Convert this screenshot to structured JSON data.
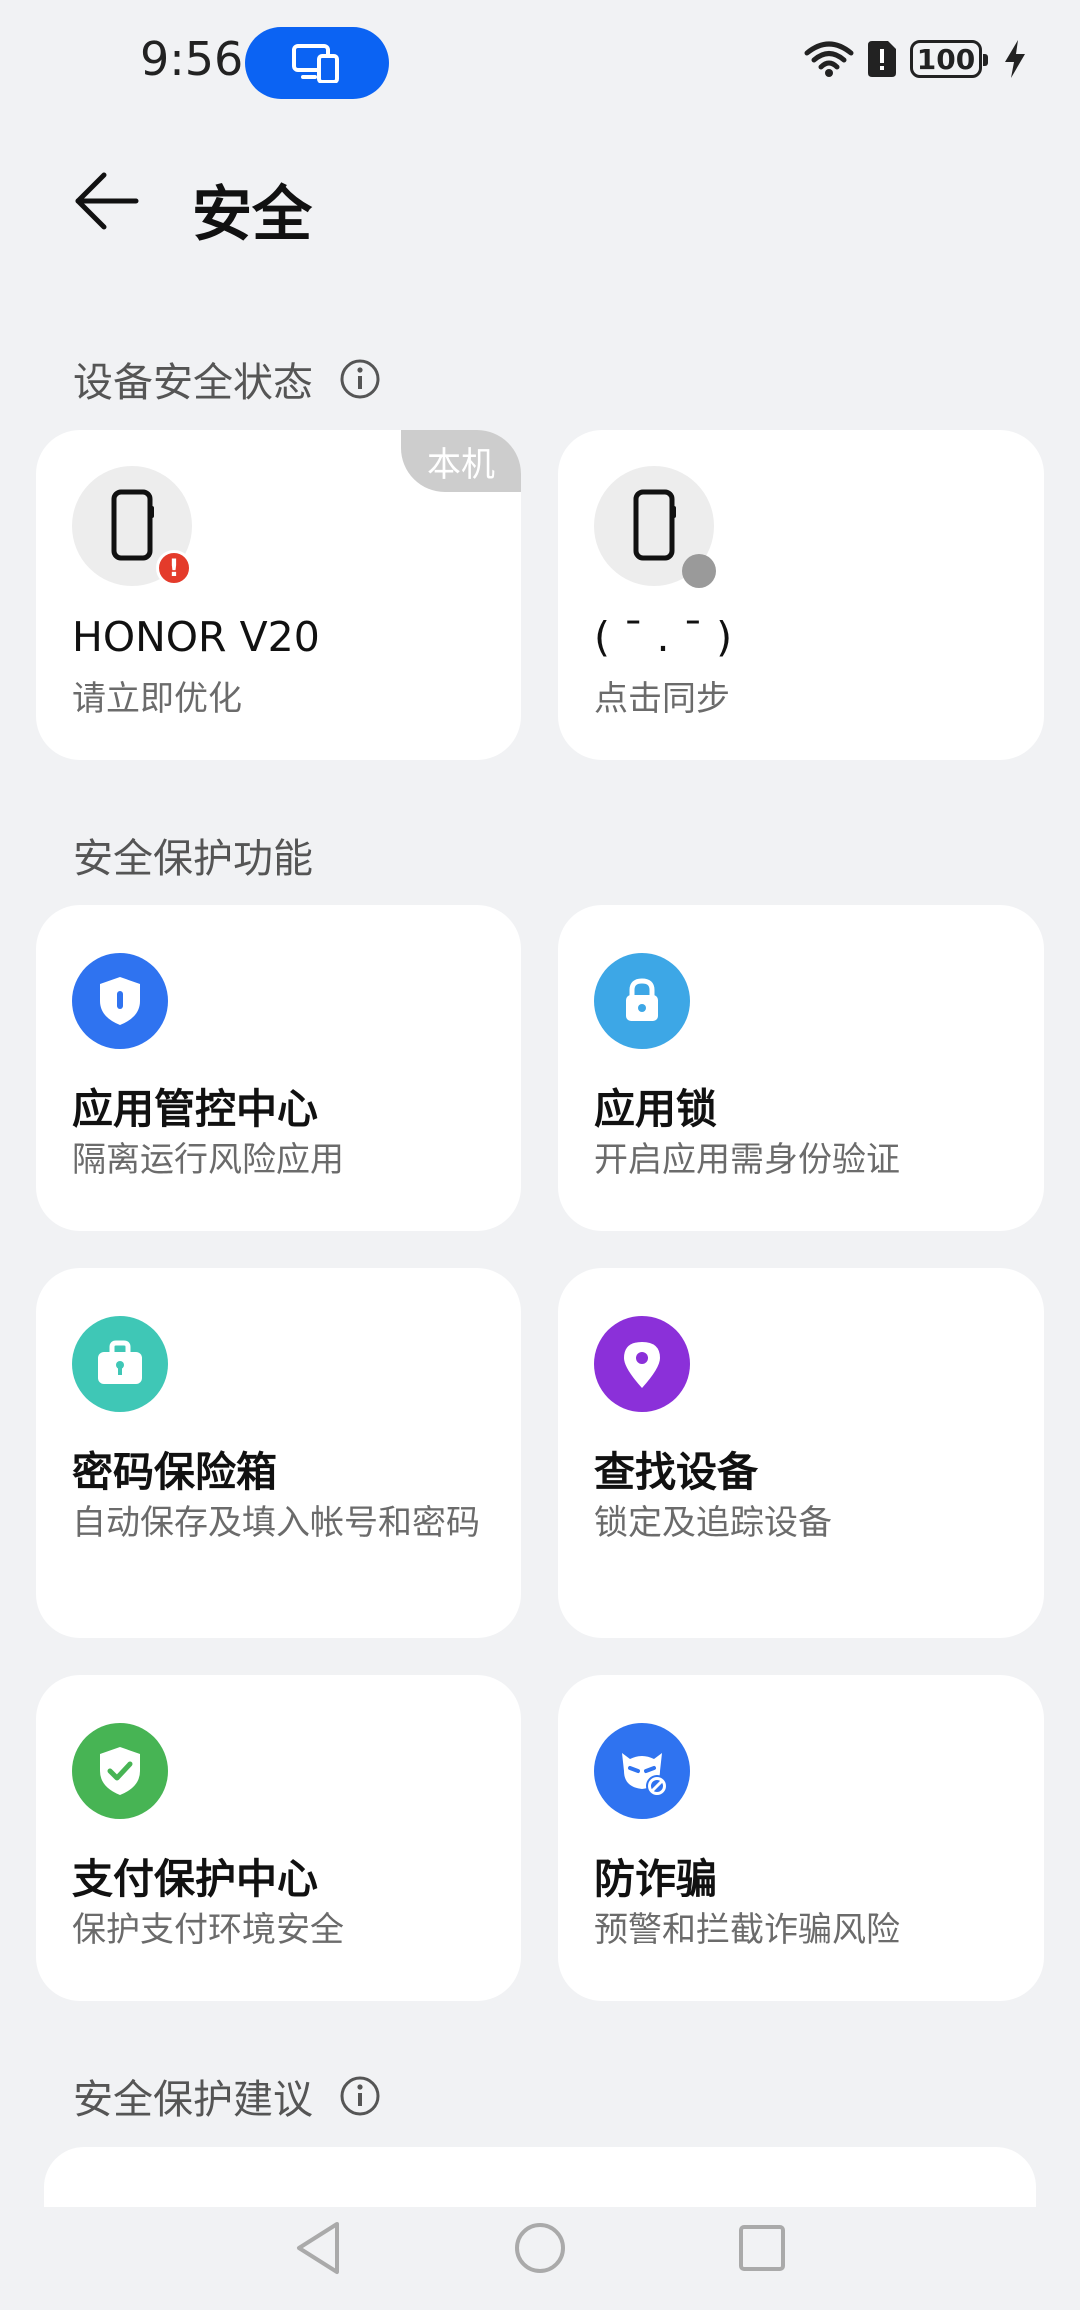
{
  "status_bar": {
    "time": "9:56",
    "battery": "100"
  },
  "header": {
    "title": "安全"
  },
  "sections": {
    "device_status": "设备安全状态",
    "protection_features": "安全保护功能",
    "suggestions": "安全保护建议"
  },
  "devices": [
    {
      "name": "HONOR V20",
      "status": "请立即优化",
      "tag": "本机"
    },
    {
      "name": "( ¯ . ¯ )",
      "status": "点击同步"
    }
  ],
  "features": [
    {
      "title": "应用管控中心",
      "desc": "隔离运行风险应用",
      "icon": "shield-icon",
      "color": "#2f73f0"
    },
    {
      "title": "应用锁",
      "desc": "开启应用需身份验证",
      "icon": "lock-icon",
      "color": "#3da7e6"
    },
    {
      "title": "密码保险箱",
      "desc": "自动保存及填入帐号和密码",
      "icon": "briefcase-lock-icon",
      "color": "#3fc7b6"
    },
    {
      "title": "查找设备",
      "desc": "锁定及追踪设备",
      "icon": "location-pin-icon",
      "color": "#8b30d9"
    },
    {
      "title": "支付保护中心",
      "desc": "保护支付环境安全",
      "icon": "shield-check-icon",
      "color": "#47b454"
    },
    {
      "title": "防诈骗",
      "desc": "预警和拦截诈骗风险",
      "icon": "fraud-block-icon",
      "color": "#2f73f0"
    }
  ],
  "colors": {
    "background": "#f1f2f4",
    "accent": "#0b63f3",
    "error_badge": "#e43b2b"
  }
}
